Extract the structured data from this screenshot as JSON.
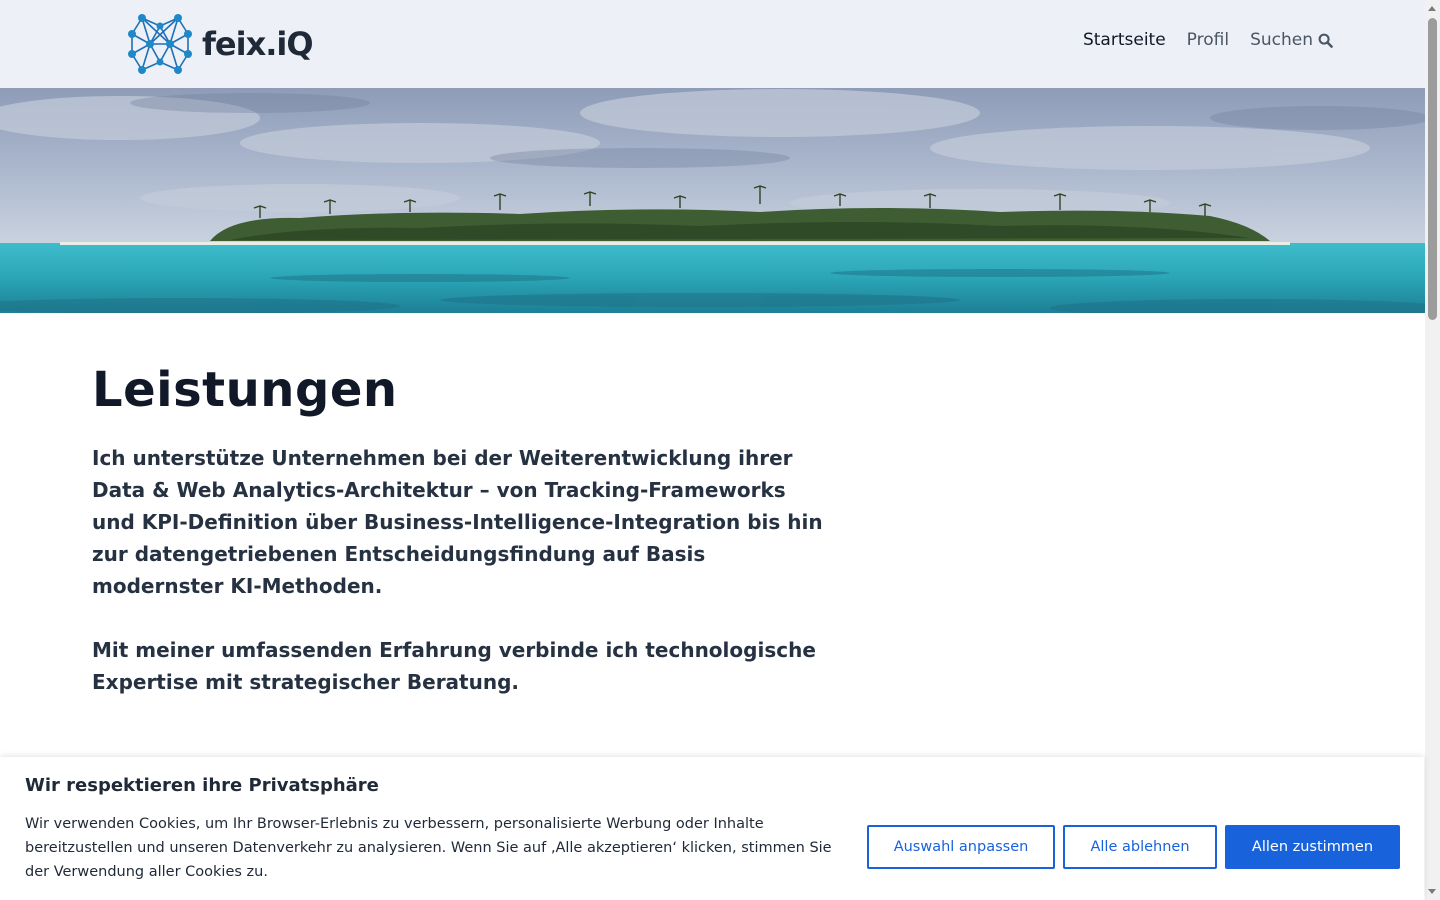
{
  "header": {
    "logo_text": "feix.iQ",
    "nav": [
      {
        "label": "Startseite",
        "active": true
      },
      {
        "label": "Profil",
        "active": false
      },
      {
        "label": "Suchen",
        "active": false,
        "icon": "search-icon"
      }
    ]
  },
  "main": {
    "title": "Leistungen",
    "intro": "Ich unterstütze Unternehmen bei der Weiterentwicklung ihrer Data & Web Analytics-Architektur – von Tracking-Frameworks und KPI-Definition über Business-Intelligence-Integration bis hin zur datengetriebenen Entscheidungsfindung auf Basis modernster KI-Methoden.",
    "intro2": "Mit meiner umfassenden Erfahrung verbinde ich technologische Expertise mit strategischer Beratung."
  },
  "cookie": {
    "title": "Wir respektieren ihre Privatsphäre",
    "text": "Wir verwenden Cookies, um Ihr Browser-Erlebnis zu verbessern, personalisierte Werbung oder Inhalte bereitzustellen und unseren Datenverkehr zu analysieren. Wenn Sie auf ‚Alle akzeptieren‘ klicken, stimmen Sie der Verwendung aller Cookies zu.",
    "customize_label": "Auswahl anpassen",
    "reject_label": "Alle ablehnen",
    "accept_label": "Allen zustimmen"
  },
  "colors": {
    "accent": "#1863dc",
    "header_bg": "#edf1f7",
    "text_dark": "#1f2937",
    "logo_blue": "#1e88c8"
  }
}
